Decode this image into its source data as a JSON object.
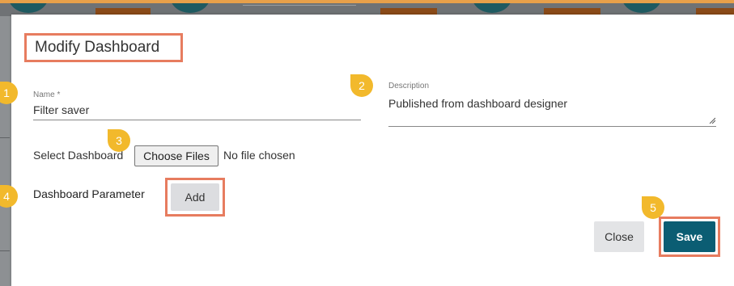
{
  "modal": {
    "title": "Modify Dashboard",
    "name_label": "Name *",
    "name_value": "Filter saver",
    "description_label": "Description",
    "description_value": "Published from dashboard designer",
    "select_dashboard_label": "Select Dashboard",
    "choose_files_label": "Choose Files",
    "no_file_text": "No file chosen",
    "dashboard_parameter_label": "Dashboard Parameter",
    "add_label": "Add",
    "close_label": "Close",
    "save_label": "Save"
  },
  "markers": [
    "1",
    "2",
    "3",
    "4",
    "5"
  ],
  "colors": {
    "accent_outline": "#e77c5f",
    "marker": "#f2b92c",
    "save_button": "#0b5d73",
    "close_button": "#e3e4e6"
  }
}
